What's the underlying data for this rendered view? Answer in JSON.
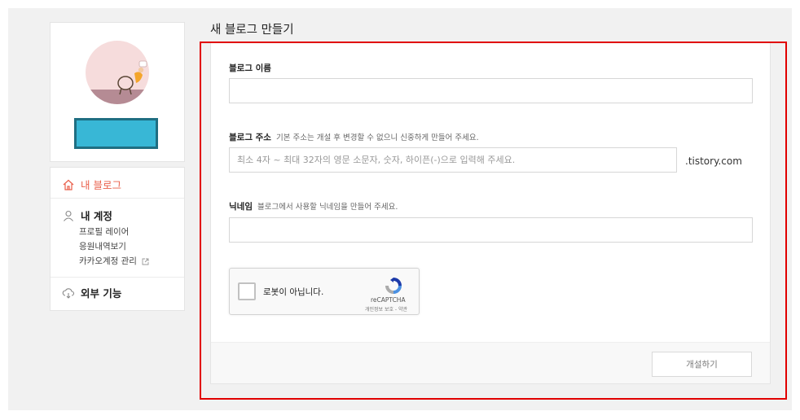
{
  "page": {
    "title": "새 블로그 만들기"
  },
  "sidebar": {
    "my_blog": "내 블로그",
    "account": {
      "label": "내 계정",
      "items": [
        "프로필 레이어",
        "응원내역보기",
        "카카오계정 관리"
      ]
    },
    "external": "외부 기능"
  },
  "form": {
    "blog_name": {
      "label": "블로그 이름",
      "value": ""
    },
    "blog_address": {
      "label": "블로그 주소",
      "help": "기본 주소는 개설 후 변경할 수 없으니 신중하게 만들어 주세요.",
      "placeholder": "최소 4자 ~ 최대 32자의 영문 소문자, 숫자, 하이픈(-)으로 입력해 주세요.",
      "value": "",
      "suffix": ".tistory.com"
    },
    "nickname": {
      "label": "닉네임",
      "help": "블로그에서 사용할 닉네임을 만들어 주세요.",
      "value": ""
    },
    "captcha": {
      "text": "로봇이 아닙니다.",
      "brand": "reCAPTCHA",
      "terms": "개인정보 보호 - 약관"
    },
    "submit": "개설하기"
  },
  "colors": {
    "accent": "#e95f4a",
    "highlight_outline": "#e10000",
    "blog_button": "#38b7d6"
  }
}
